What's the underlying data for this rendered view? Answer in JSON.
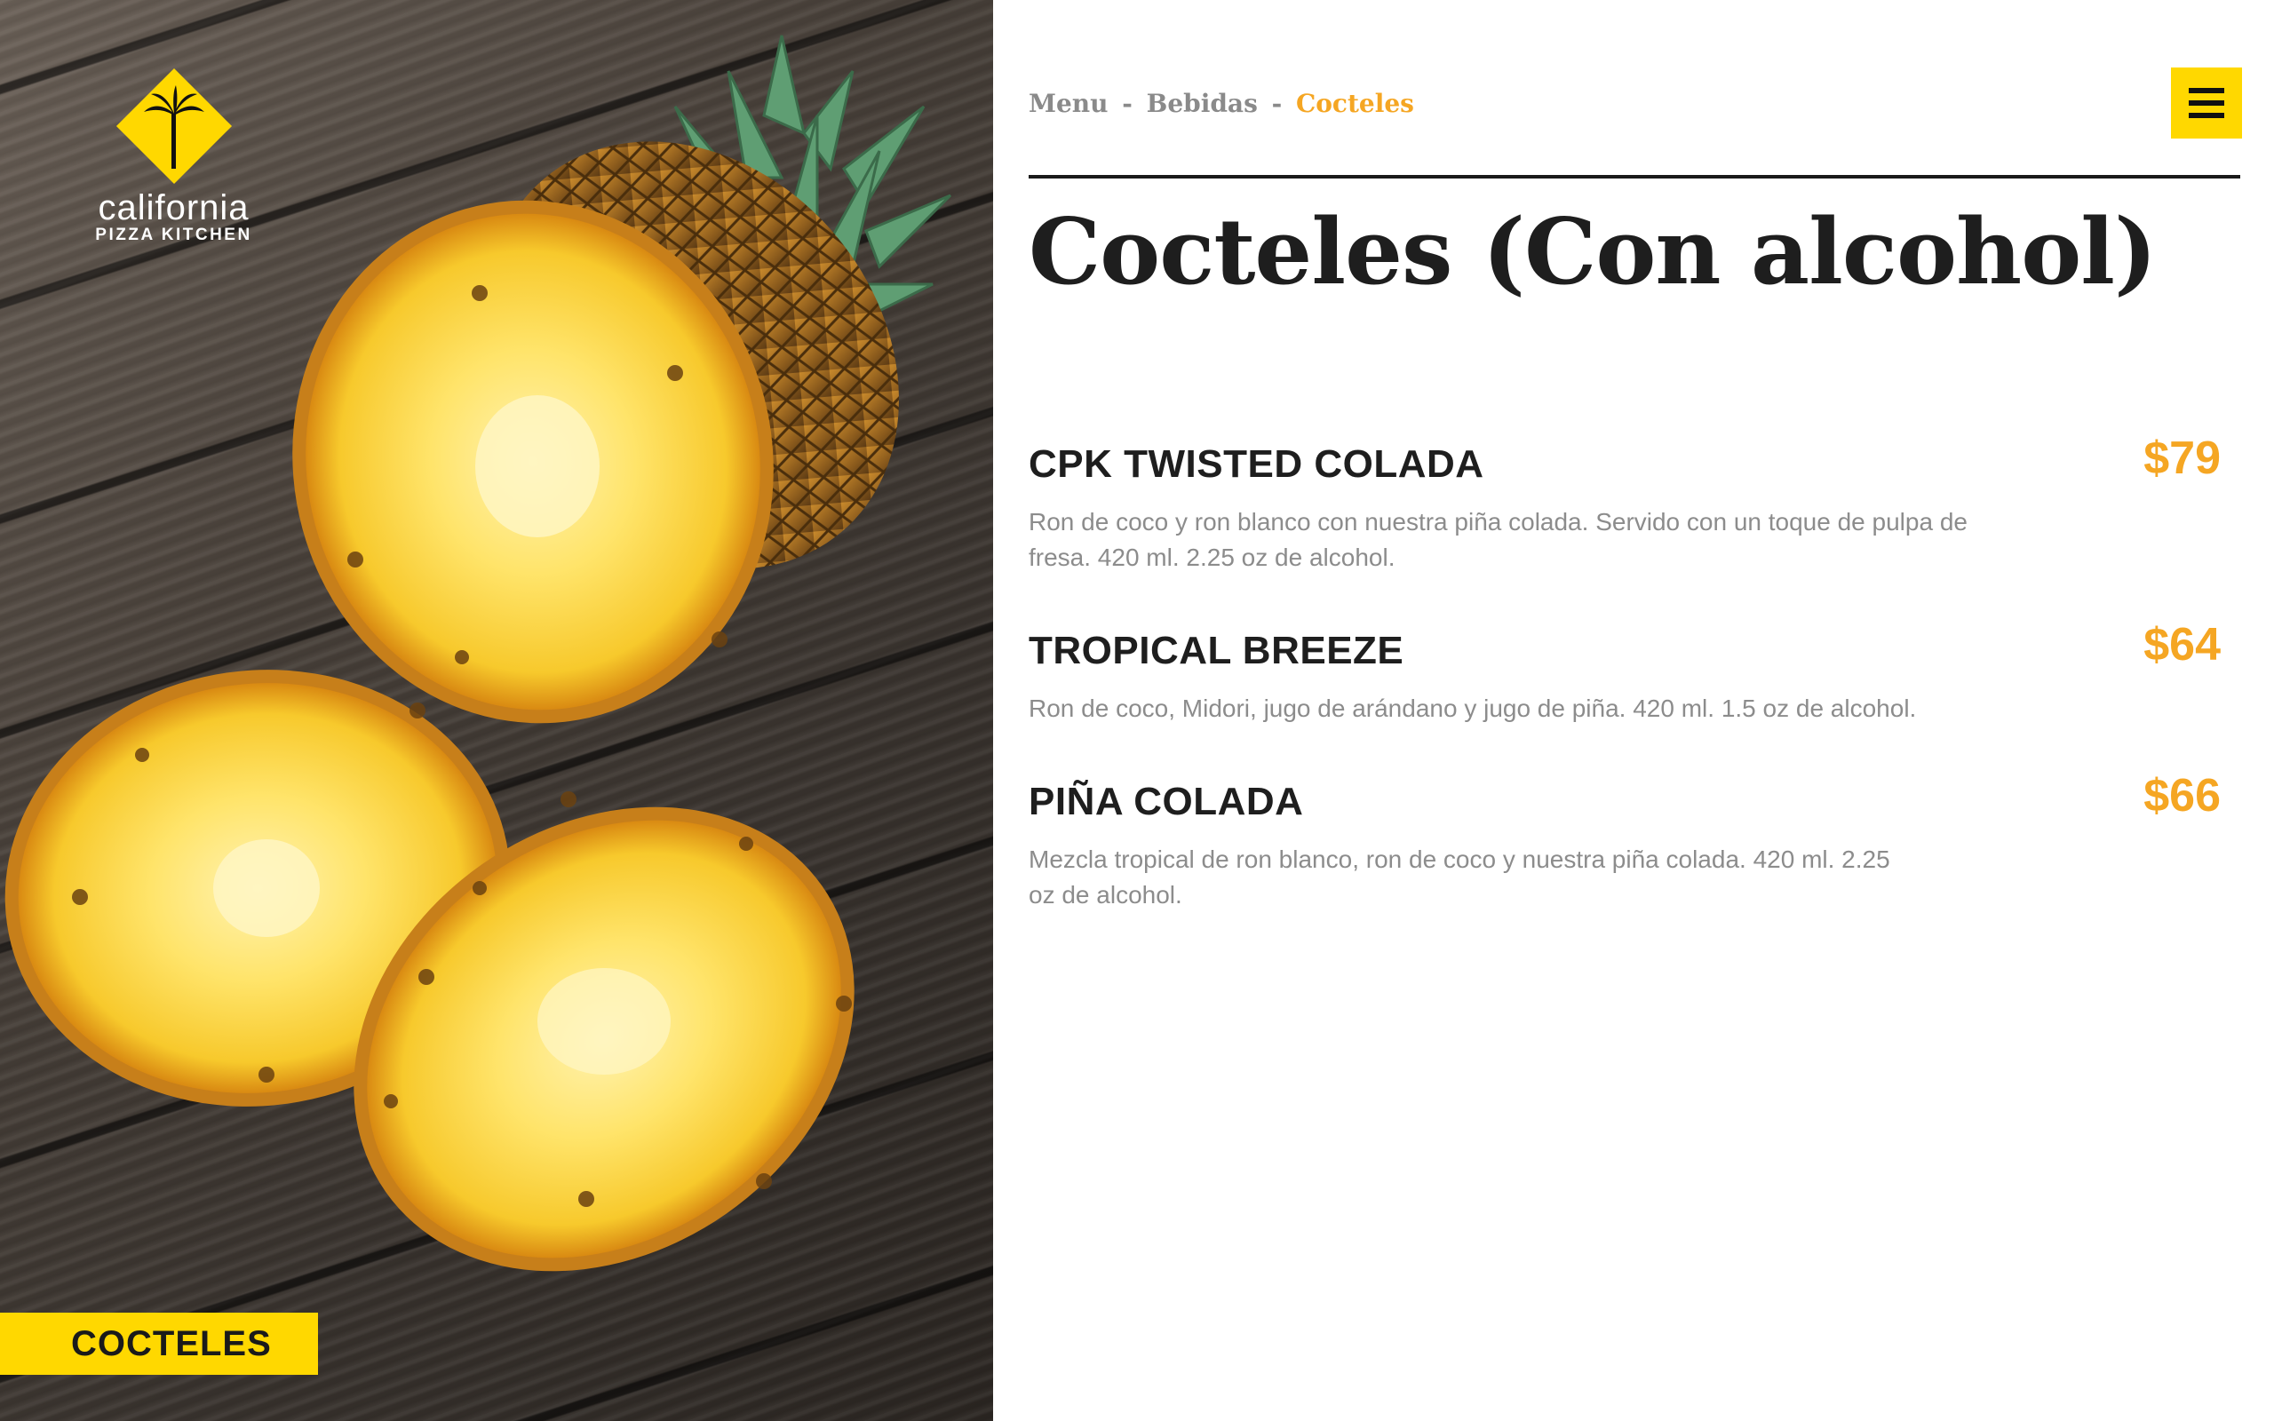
{
  "brand": {
    "logo_line_1": "california",
    "logo_line_2": "PIZZA KITCHEN",
    "accent_color": "#ffd800",
    "price_color": "#f5a623"
  },
  "hero": {
    "category_tag": "COCTELES"
  },
  "breadcrumb": {
    "items": [
      "Menu",
      "Bebidas",
      "Cocteles"
    ],
    "separator": "-"
  },
  "header": {
    "menu_icon": "hamburger-menu-icon"
  },
  "page": {
    "title": "Cocteles (Con alcohol)"
  },
  "menu_items": [
    {
      "name": "CPK TWISTED COLADA",
      "price": "$79",
      "description": "Ron de coco y ron blanco con nuestra piña colada. Servido con un toque de pulpa de fresa. 420 ml. 2.25 oz de alcohol."
    },
    {
      "name": "TROPICAL BREEZE",
      "price": "$64",
      "description": "Ron de coco, Midori, jugo de arándano y jugo de piña. 420 ml. 1.5 oz de alcohol."
    },
    {
      "name": "PIÑA COLADA",
      "price": "$66",
      "description": "Mezcla tropical de ron blanco, ron de coco y nuestra piña colada. 420 ml. 2.25 oz de alcohol."
    }
  ]
}
